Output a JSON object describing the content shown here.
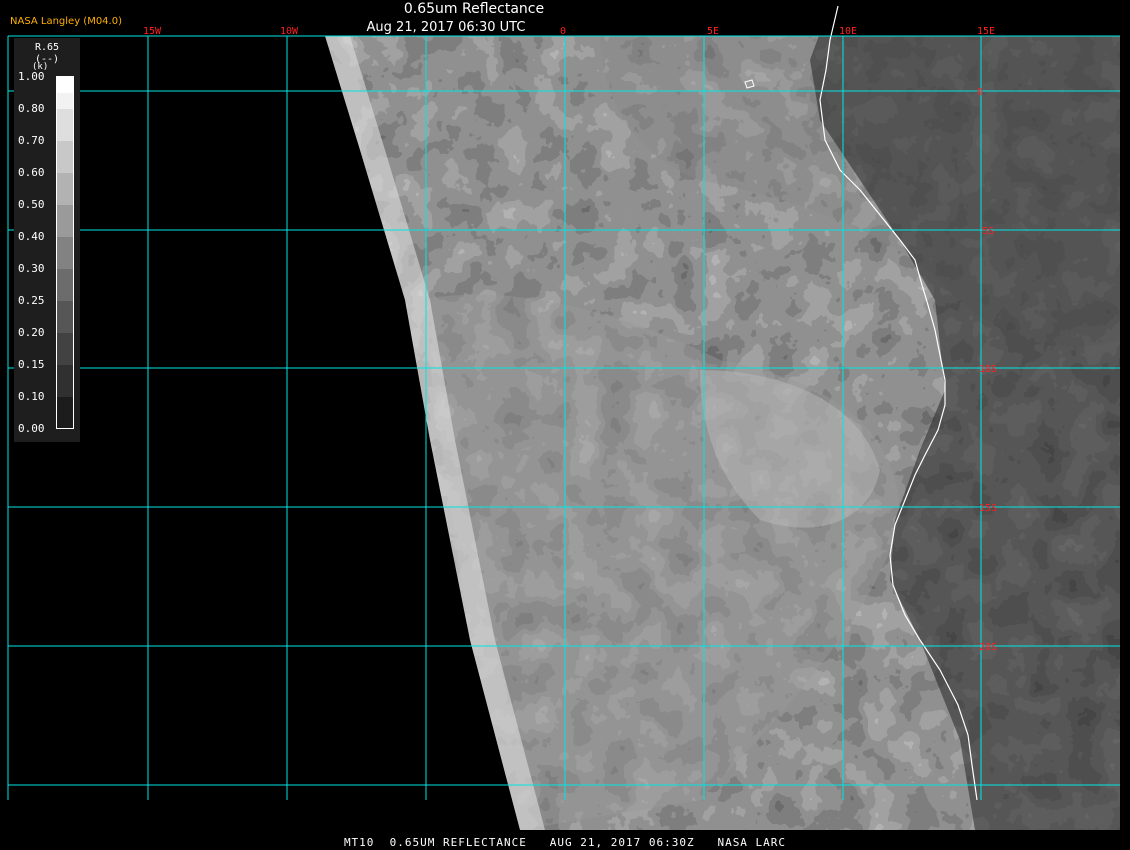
{
  "header": {
    "title": "0.65um Reflectance",
    "timestamp": "Aug 21, 2017 06:30 UTC",
    "credit": "NASA Langley (M04.0)"
  },
  "footer": {
    "caption": "MT10  0.65UM REFLECTANCE   AUG 21, 2017 06:30Z   NASA LARC"
  },
  "legend": {
    "var_name": "R.65",
    "units": "(--)",
    "unit_symbol": "(k)",
    "ticks": [
      "1.00",
      "0.80",
      "0.70",
      "0.60",
      "0.50",
      "0.40",
      "0.30",
      "0.25",
      "0.20",
      "0.15",
      "0.10",
      "0.00"
    ]
  },
  "map": {
    "lon_labels": [
      "15W",
      "10W",
      "0",
      "5E",
      "10E",
      "15E"
    ],
    "lat_labels": [
      "0",
      "5S",
      "10S",
      "15S",
      "20S"
    ],
    "grid_color": "#00e5e5",
    "label_color": "#ff2020"
  }
}
